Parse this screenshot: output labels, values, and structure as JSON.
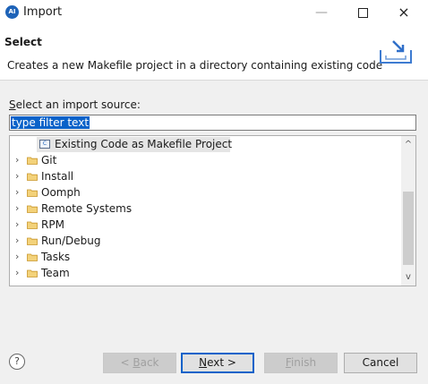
{
  "window": {
    "title": "Import",
    "icon_text": "AI",
    "controls": {
      "close": "×"
    }
  },
  "header": {
    "title": "Select",
    "description": "Creates a new Makefile project in a directory containing existing code"
  },
  "source": {
    "label_prefix": "S",
    "label_rest": "elect an import source:",
    "filter_placeholder": "type filter text"
  },
  "tree": {
    "selected_child": {
      "label": "Existing Code as Makefile Project",
      "icon": "makefile-project-icon"
    },
    "items": [
      {
        "label": "Git"
      },
      {
        "label": "Install"
      },
      {
        "label": "Oomph"
      },
      {
        "label": "Remote Systems"
      },
      {
        "label": "RPM"
      },
      {
        "label": "Run/Debug"
      },
      {
        "label": "Tasks"
      },
      {
        "label": "Team"
      }
    ],
    "chevron": "›",
    "scroll_up": "^",
    "scroll_down": "v"
  },
  "buttons": {
    "help": "?",
    "back_prefix": "< ",
    "back_key": "B",
    "back_rest": "ack",
    "next_key": "N",
    "next_rest": "ext >",
    "finish_key": "F",
    "finish_rest": "inish",
    "cancel": "Cancel"
  },
  "colors": {
    "accent": "#0a62c9",
    "folder": "#e8b94a"
  }
}
